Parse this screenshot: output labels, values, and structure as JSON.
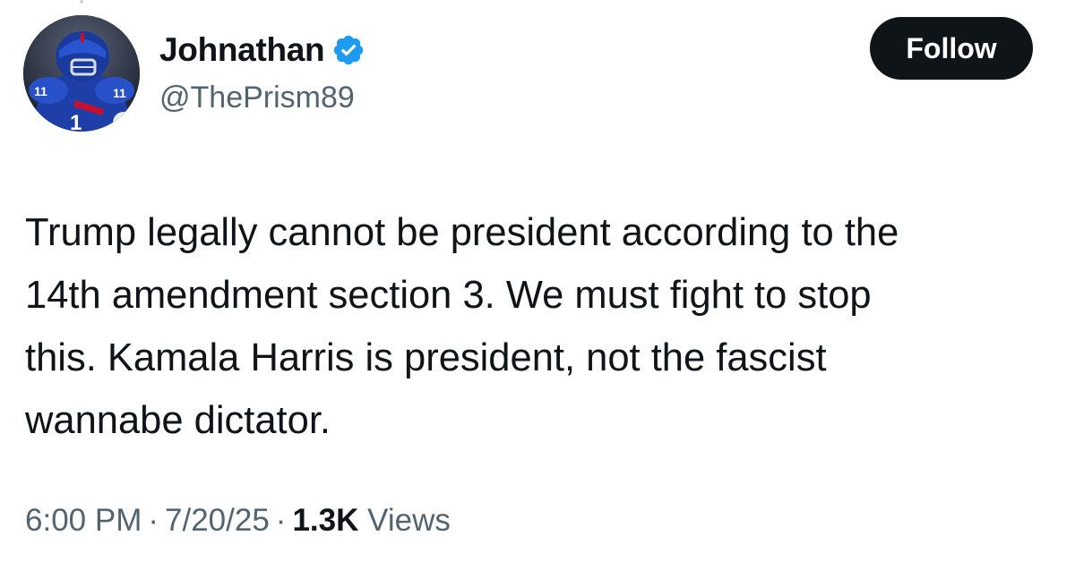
{
  "author": {
    "display_name": "Johnathan",
    "handle": "@ThePrism89",
    "verified": true,
    "avatar": "football-player-avatar"
  },
  "follow_button": {
    "label": "Follow"
  },
  "tweet": {
    "lines": [
      "Trump legally cannot be president according to the",
      "14th amendment section 3. We must fight to stop",
      "this. Kamala Harris is president, not the fascist",
      "wannabe dictator."
    ]
  },
  "meta": {
    "time": "6:00 PM",
    "separator": "·",
    "date": "7/20/25",
    "views_count": "1.3K",
    "views_label": "Views"
  },
  "colors": {
    "text_primary": "#0f1419",
    "text_secondary": "#536471",
    "verified_blue": "#1d9bf0",
    "button_bg": "#0f1419"
  }
}
